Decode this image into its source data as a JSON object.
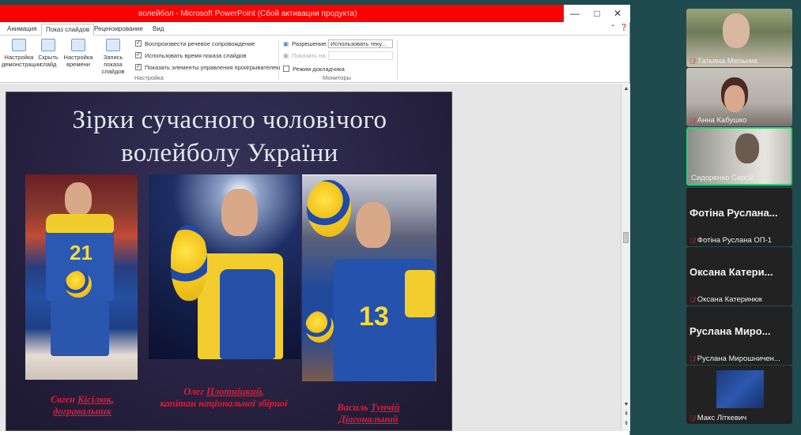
{
  "window": {
    "title": "волейбол - Microsoft PowerPoint (Сбой активации продукта)",
    "controls": [
      "—",
      "□",
      "✕"
    ]
  },
  "ribbon": {
    "tabs": [
      "Анимация",
      "Показ слайдов",
      "Рецензирование",
      "Вид"
    ],
    "active_tab": "Показ слайдов",
    "buttons": [
      {
        "label": "Настройка демонстрации"
      },
      {
        "label": "Скрыть слайд"
      },
      {
        "label": "Настройка времени"
      },
      {
        "label": "Запись показа слайдов"
      }
    ],
    "checkboxes": [
      {
        "label": "Воспроизвести речевое сопровождение",
        "checked": true
      },
      {
        "label": "Использовать время показа слайдов",
        "checked": true
      },
      {
        "label": "Показать элементы управления проигрывателем",
        "checked": true
      }
    ],
    "group_setup": "Настройка",
    "resolution_label": "Разрешение:",
    "resolution_value": "Использовать теку...",
    "show_on_label": "Показать на:",
    "presenter_view_label": "Режим докладчика",
    "group_monitors": "Мониторы"
  },
  "slide": {
    "title_line1": "Зірки сучасного чоловічого",
    "title_line2": "волейболу України",
    "players": [
      {
        "first": "Євген",
        "last": "Кісілюк",
        "role": "догравальник",
        "number": "21"
      },
      {
        "first": "Олег",
        "last": "Плотніцкий",
        "role": "капітан національної збірної",
        "number": ""
      },
      {
        "first": "Василь",
        "last": "Тупчій",
        "role": "Діагональний",
        "number": "13"
      }
    ]
  },
  "participants": [
    {
      "name": "Татьяна Мельник",
      "big": "",
      "video": true
    },
    {
      "name": "Анна Кабушко",
      "big": "",
      "video": true
    },
    {
      "name": "Сидоренко Сергій",
      "big": "",
      "video": true,
      "active": true
    },
    {
      "name": "Фотіна Руслана ОП-1",
      "big": "Фотіна Руслана..."
    },
    {
      "name": "Оксана Катеринюк",
      "big": "Оксана Катери..."
    },
    {
      "name": "Руслана Мирошничен...",
      "big": "Руслана Миро..."
    },
    {
      "name": "Макс Літкевич",
      "big": "",
      "video": true
    }
  ]
}
